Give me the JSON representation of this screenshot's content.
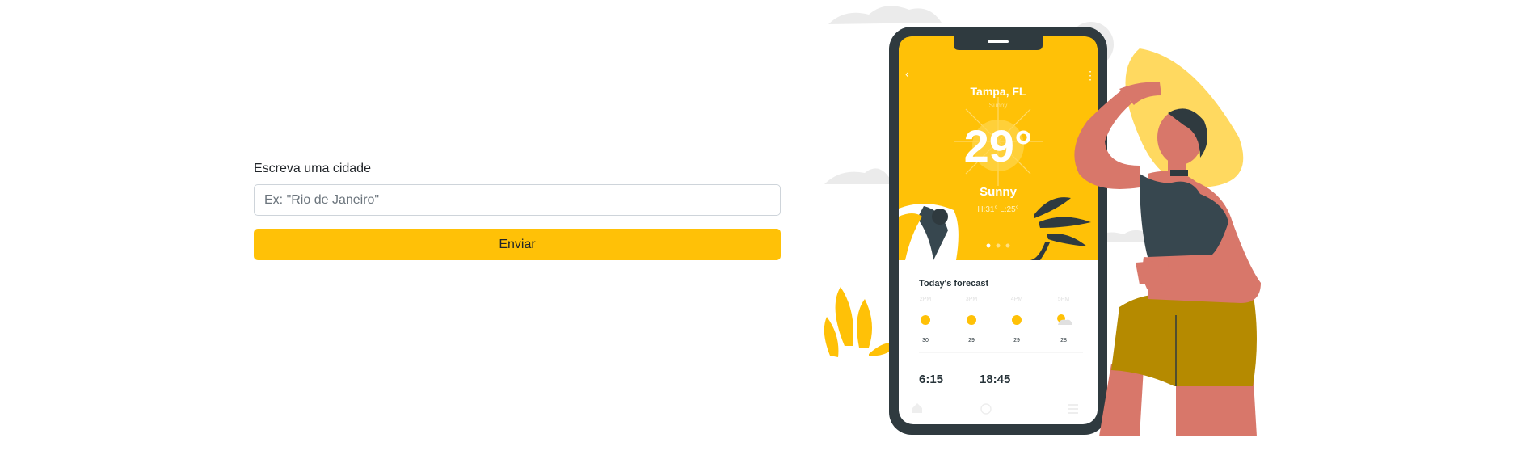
{
  "form": {
    "label": "Escreva uma cidade",
    "placeholder": "Ex: \"Rio de Janeiro\"",
    "submit_label": "Enviar"
  },
  "illustration": {
    "city": "Tampa, FL",
    "condition_small": "Sunny",
    "temperature": "29°",
    "condition": "Sunny",
    "high_low": "H:31°   L:25°",
    "forecast_title": "Today's forecast",
    "hours": [
      {
        "time": "2PM",
        "temp": "30",
        "icon": "sun-icon"
      },
      {
        "time": "3PM",
        "temp": "29",
        "icon": "sun-icon"
      },
      {
        "time": "4PM",
        "temp": "29",
        "icon": "sun-icon"
      },
      {
        "time": "5PM",
        "temp": "28",
        "icon": "partly-cloudy-icon"
      }
    ],
    "sunrise": "6:15",
    "sunset": "18:45",
    "colors": {
      "accent": "#ffc107",
      "phone": "#2f3a3f",
      "skin": "#d8776a",
      "shorts": "#b58a00"
    }
  }
}
